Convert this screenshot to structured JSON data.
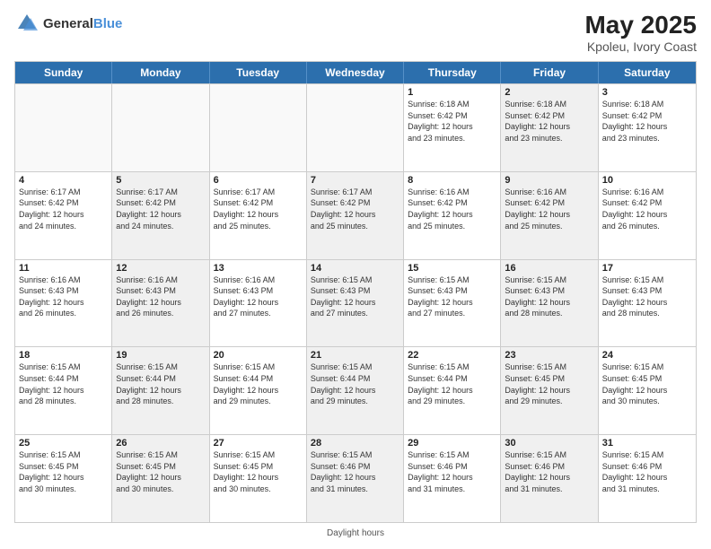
{
  "header": {
    "logo_general": "General",
    "logo_blue": "Blue",
    "title": "May 2025",
    "subtitle": "Kpoleu, Ivory Coast"
  },
  "days_of_week": [
    "Sunday",
    "Monday",
    "Tuesday",
    "Wednesday",
    "Thursday",
    "Friday",
    "Saturday"
  ],
  "footer_text": "Daylight hours",
  "weeks": [
    [
      {
        "day": "",
        "info": "",
        "shaded": false,
        "empty": true
      },
      {
        "day": "",
        "info": "",
        "shaded": false,
        "empty": true
      },
      {
        "day": "",
        "info": "",
        "shaded": false,
        "empty": true
      },
      {
        "day": "",
        "info": "",
        "shaded": false,
        "empty": true
      },
      {
        "day": "1",
        "info": "Sunrise: 6:18 AM\nSunset: 6:42 PM\nDaylight: 12 hours\nand 23 minutes.",
        "shaded": false,
        "empty": false
      },
      {
        "day": "2",
        "info": "Sunrise: 6:18 AM\nSunset: 6:42 PM\nDaylight: 12 hours\nand 23 minutes.",
        "shaded": true,
        "empty": false
      },
      {
        "day": "3",
        "info": "Sunrise: 6:18 AM\nSunset: 6:42 PM\nDaylight: 12 hours\nand 23 minutes.",
        "shaded": false,
        "empty": false
      }
    ],
    [
      {
        "day": "4",
        "info": "Sunrise: 6:17 AM\nSunset: 6:42 PM\nDaylight: 12 hours\nand 24 minutes.",
        "shaded": false,
        "empty": false
      },
      {
        "day": "5",
        "info": "Sunrise: 6:17 AM\nSunset: 6:42 PM\nDaylight: 12 hours\nand 24 minutes.",
        "shaded": true,
        "empty": false
      },
      {
        "day": "6",
        "info": "Sunrise: 6:17 AM\nSunset: 6:42 PM\nDaylight: 12 hours\nand 25 minutes.",
        "shaded": false,
        "empty": false
      },
      {
        "day": "7",
        "info": "Sunrise: 6:17 AM\nSunset: 6:42 PM\nDaylight: 12 hours\nand 25 minutes.",
        "shaded": true,
        "empty": false
      },
      {
        "day": "8",
        "info": "Sunrise: 6:16 AM\nSunset: 6:42 PM\nDaylight: 12 hours\nand 25 minutes.",
        "shaded": false,
        "empty": false
      },
      {
        "day": "9",
        "info": "Sunrise: 6:16 AM\nSunset: 6:42 PM\nDaylight: 12 hours\nand 25 minutes.",
        "shaded": true,
        "empty": false
      },
      {
        "day": "10",
        "info": "Sunrise: 6:16 AM\nSunset: 6:42 PM\nDaylight: 12 hours\nand 26 minutes.",
        "shaded": false,
        "empty": false
      }
    ],
    [
      {
        "day": "11",
        "info": "Sunrise: 6:16 AM\nSunset: 6:43 PM\nDaylight: 12 hours\nand 26 minutes.",
        "shaded": false,
        "empty": false
      },
      {
        "day": "12",
        "info": "Sunrise: 6:16 AM\nSunset: 6:43 PM\nDaylight: 12 hours\nand 26 minutes.",
        "shaded": true,
        "empty": false
      },
      {
        "day": "13",
        "info": "Sunrise: 6:16 AM\nSunset: 6:43 PM\nDaylight: 12 hours\nand 27 minutes.",
        "shaded": false,
        "empty": false
      },
      {
        "day": "14",
        "info": "Sunrise: 6:15 AM\nSunset: 6:43 PM\nDaylight: 12 hours\nand 27 minutes.",
        "shaded": true,
        "empty": false
      },
      {
        "day": "15",
        "info": "Sunrise: 6:15 AM\nSunset: 6:43 PM\nDaylight: 12 hours\nand 27 minutes.",
        "shaded": false,
        "empty": false
      },
      {
        "day": "16",
        "info": "Sunrise: 6:15 AM\nSunset: 6:43 PM\nDaylight: 12 hours\nand 28 minutes.",
        "shaded": true,
        "empty": false
      },
      {
        "day": "17",
        "info": "Sunrise: 6:15 AM\nSunset: 6:43 PM\nDaylight: 12 hours\nand 28 minutes.",
        "shaded": false,
        "empty": false
      }
    ],
    [
      {
        "day": "18",
        "info": "Sunrise: 6:15 AM\nSunset: 6:44 PM\nDaylight: 12 hours\nand 28 minutes.",
        "shaded": false,
        "empty": false
      },
      {
        "day": "19",
        "info": "Sunrise: 6:15 AM\nSunset: 6:44 PM\nDaylight: 12 hours\nand 28 minutes.",
        "shaded": true,
        "empty": false
      },
      {
        "day": "20",
        "info": "Sunrise: 6:15 AM\nSunset: 6:44 PM\nDaylight: 12 hours\nand 29 minutes.",
        "shaded": false,
        "empty": false
      },
      {
        "day": "21",
        "info": "Sunrise: 6:15 AM\nSunset: 6:44 PM\nDaylight: 12 hours\nand 29 minutes.",
        "shaded": true,
        "empty": false
      },
      {
        "day": "22",
        "info": "Sunrise: 6:15 AM\nSunset: 6:44 PM\nDaylight: 12 hours\nand 29 minutes.",
        "shaded": false,
        "empty": false
      },
      {
        "day": "23",
        "info": "Sunrise: 6:15 AM\nSunset: 6:45 PM\nDaylight: 12 hours\nand 29 minutes.",
        "shaded": true,
        "empty": false
      },
      {
        "day": "24",
        "info": "Sunrise: 6:15 AM\nSunset: 6:45 PM\nDaylight: 12 hours\nand 30 minutes.",
        "shaded": false,
        "empty": false
      }
    ],
    [
      {
        "day": "25",
        "info": "Sunrise: 6:15 AM\nSunset: 6:45 PM\nDaylight: 12 hours\nand 30 minutes.",
        "shaded": false,
        "empty": false
      },
      {
        "day": "26",
        "info": "Sunrise: 6:15 AM\nSunset: 6:45 PM\nDaylight: 12 hours\nand 30 minutes.",
        "shaded": true,
        "empty": false
      },
      {
        "day": "27",
        "info": "Sunrise: 6:15 AM\nSunset: 6:45 PM\nDaylight: 12 hours\nand 30 minutes.",
        "shaded": false,
        "empty": false
      },
      {
        "day": "28",
        "info": "Sunrise: 6:15 AM\nSunset: 6:46 PM\nDaylight: 12 hours\nand 31 minutes.",
        "shaded": true,
        "empty": false
      },
      {
        "day": "29",
        "info": "Sunrise: 6:15 AM\nSunset: 6:46 PM\nDaylight: 12 hours\nand 31 minutes.",
        "shaded": false,
        "empty": false
      },
      {
        "day": "30",
        "info": "Sunrise: 6:15 AM\nSunset: 6:46 PM\nDaylight: 12 hours\nand 31 minutes.",
        "shaded": true,
        "empty": false
      },
      {
        "day": "31",
        "info": "Sunrise: 6:15 AM\nSunset: 6:46 PM\nDaylight: 12 hours\nand 31 minutes.",
        "shaded": false,
        "empty": false
      }
    ]
  ]
}
